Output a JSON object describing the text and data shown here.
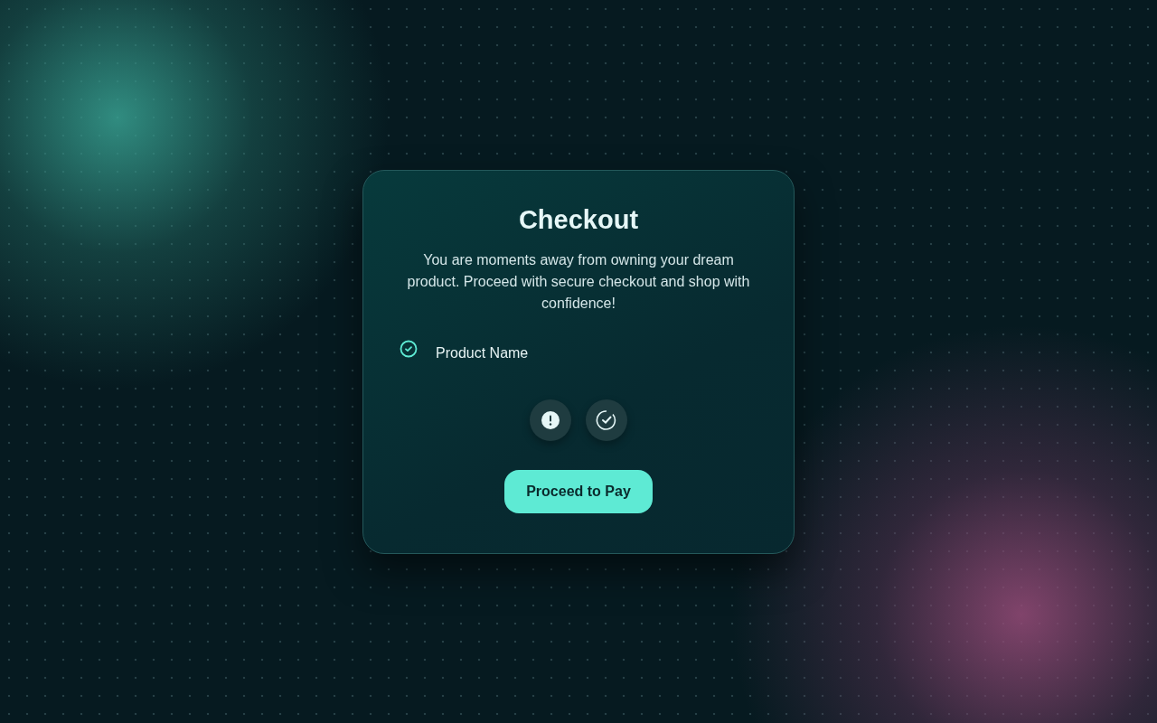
{
  "card": {
    "title": "Checkout",
    "description": "You are moments away from owning your dream product. Proceed with secure checkout and shop with confidence!",
    "items": [
      {
        "label": "Product Name"
      }
    ],
    "button": "Proceed to Pay"
  }
}
